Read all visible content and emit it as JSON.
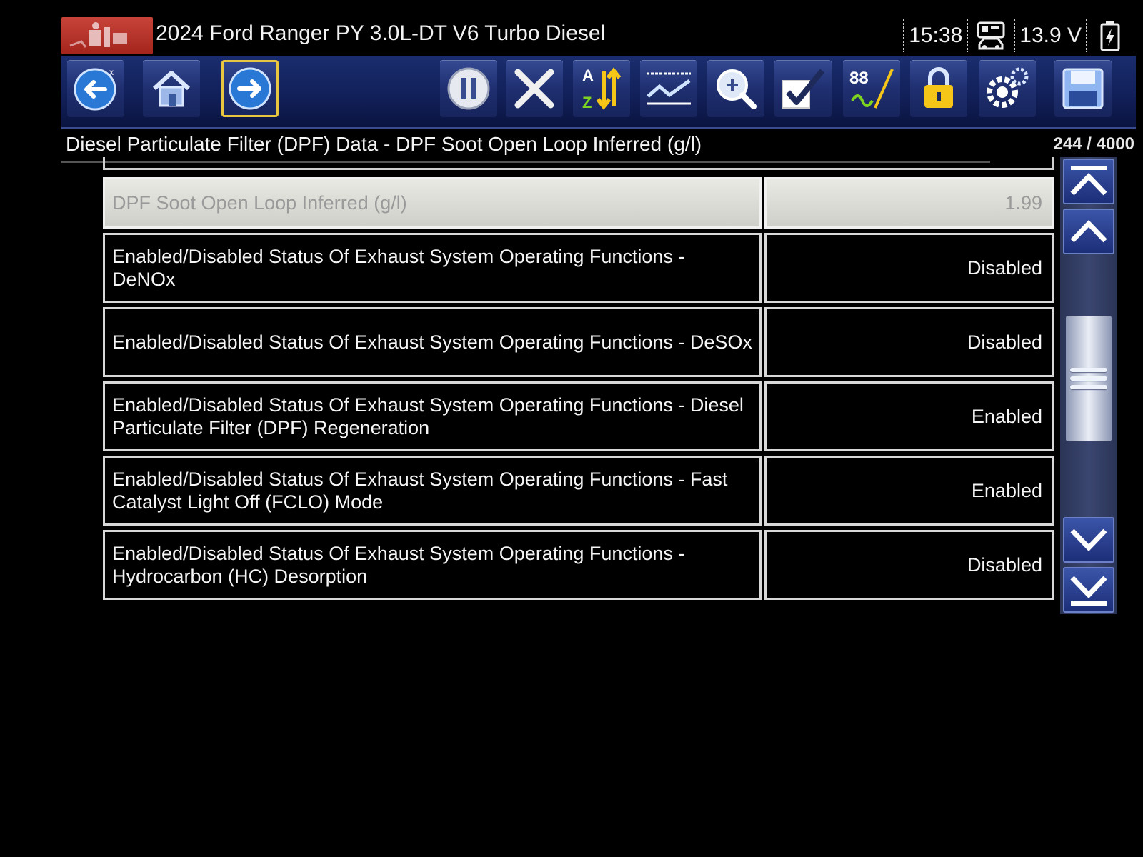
{
  "header": {
    "vehicle_title": "2024 Ford Ranger PY 3.0L-DT V6 Turbo Diesel",
    "time": "15:38",
    "voltage": "13.9 V"
  },
  "toolbar": {
    "buttons": [
      {
        "icon": "back-arrow-icon"
      },
      {
        "icon": "home-icon"
      },
      {
        "icon": "forward-arrow-icon",
        "selected": true
      },
      {
        "icon": "pause-icon"
      },
      {
        "icon": "close-x-icon"
      },
      {
        "icon": "sort-az-icon"
      },
      {
        "icon": "graph-icon"
      },
      {
        "icon": "zoom-icon"
      },
      {
        "icon": "checkmark-icon"
      },
      {
        "icon": "units-88-icon"
      },
      {
        "icon": "lock-icon"
      },
      {
        "icon": "settings-gear-icon"
      },
      {
        "icon": "save-icon"
      }
    ]
  },
  "screen": {
    "title": "Diesel Particulate Filter (DPF) Data - DPF Soot Open Loop Inferred (g/l)",
    "counter": "244 / 4000"
  },
  "rows": [
    {
      "name": "DPF Soot Open Loop Inferred (g/l)",
      "value": "1.99",
      "highlighted": true
    },
    {
      "name": "Enabled/Disabled Status Of Exhaust System Operating Functions - DeNOx",
      "value": "Disabled"
    },
    {
      "name": "Enabled/Disabled Status Of Exhaust System Operating Functions - DeSOx",
      "value": "Disabled"
    },
    {
      "name": "Enabled/Disabled Status Of Exhaust System Operating Functions - Diesel Particulate Filter (DPF) Regeneration",
      "value": "Enabled"
    },
    {
      "name": "Enabled/Disabled Status Of Exhaust System Operating Functions - Fast Catalyst Light Off (FCLO) Mode",
      "value": "Enabled"
    },
    {
      "name": "Enabled/Disabled Status Of Exhaust System Operating Functions - Hydrocarbon (HC) Desorption",
      "value": "Disabled"
    }
  ],
  "colors": {
    "toolbar_bg": "#12205a",
    "selected_outline": "#e9c640",
    "highlight_row": "#dcdcd6"
  }
}
